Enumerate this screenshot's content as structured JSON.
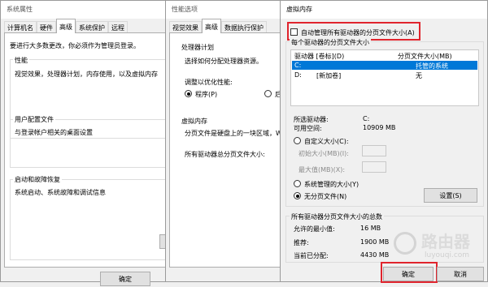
{
  "sys": {
    "title": "系统属性",
    "tabs": [
      "计算机名",
      "硬件",
      "高级",
      "系统保护",
      "远程"
    ],
    "admin_note": "要进行大多数更改，你必须作为管理员登录。",
    "perf_label": "性能",
    "perf_desc": "视觉效果，处理器计划，内存使用，以及虚拟内存",
    "profile_label": "用户配置文件",
    "profile_desc": "与登录帐户相关的桌面设置",
    "startup_label": "启动和故障恢复",
    "startup_desc": "系统启动、系统故障和调试信息",
    "ok": "确定"
  },
  "perf": {
    "title": "性能选项",
    "tabs": [
      "视觉效果",
      "高级",
      "数据执行保护"
    ],
    "proc_label": "处理器计划",
    "proc_desc": "选择如何分配处理器资源。",
    "adjust_label": "调整以优化性能:",
    "opt_program": "程序(P)",
    "opt_background": "后台",
    "vm_label": "虚拟内存",
    "vm_desc": "分页文件是硬盘上的一块区域，Wi",
    "vm_total": "所有驱动器总分页文件大小:"
  },
  "vm": {
    "title": "虚拟内存",
    "auto_manage": "自动管理所有驱动器的分页文件大小(A)",
    "per_drive": "每个驱动器的分页文件大小",
    "col_drive": "驱动器 [卷标](D)",
    "col_size": "分页文件大小(MB)",
    "drives": [
      {
        "drive": "C:",
        "label": "",
        "size": "托管的系统"
      },
      {
        "drive": "D:",
        "label": "[新加卷]",
        "size": "无"
      }
    ],
    "selected_label": "所选驱动器:",
    "selected_value": "C:",
    "space_label": "可用空间:",
    "space_value": "10909 MB",
    "custom": "自定义大小(C):",
    "initial": "初始大小(MB)(I):",
    "max": "最大值(MB)(X):",
    "system_managed": "系统管理的大小(Y)",
    "no_paging": "无分页文件(N)",
    "set_btn": "设置(S)",
    "total_label": "所有驱动器分页文件大小的总数",
    "min_label": "允许的最小值:",
    "min_value": "16 MB",
    "rec_label": "推荐:",
    "rec_value": "1900 MB",
    "cur_label": "当前已分配:",
    "cur_value": "4430 MB",
    "ok": "确定",
    "cancel": "取消"
  },
  "watermark": "路由器",
  "watermark_sub": "luyouqi.com"
}
